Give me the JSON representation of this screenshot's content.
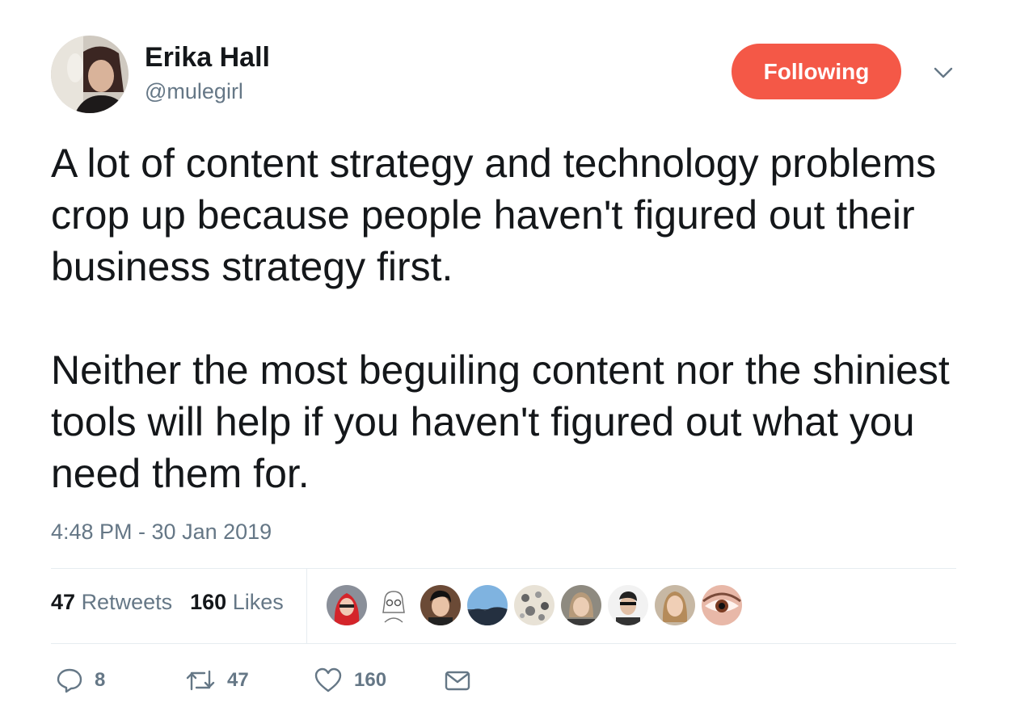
{
  "user": {
    "name": "Erika Hall",
    "handle": "@mulegirl"
  },
  "follow_button": {
    "label": "Following",
    "color": "#f45847"
  },
  "tweet": {
    "paragraphs": [
      "A lot of content strategy and technology problems crop up because people haven't figured out their business strategy first.",
      "Neither the most beguiling content nor the shiniest tools will help if you haven't figured out what you need them for."
    ],
    "timestamp": "4:48 PM - 30 Jan 2019"
  },
  "stats": {
    "retweets_count": "47",
    "retweets_label": "Retweets",
    "likes_count": "160",
    "likes_label": "Likes"
  },
  "likers_count_shown": 9,
  "actions": {
    "replies": "8",
    "retweets": "47",
    "likes": "160"
  },
  "icons": {
    "options": "chevron-down-icon",
    "reply": "reply-icon",
    "retweet": "retweet-icon",
    "like": "heart-icon",
    "message": "envelope-icon"
  },
  "colors": {
    "text": "#14171a",
    "muted": "#657786",
    "divider": "#e6ecf0"
  }
}
